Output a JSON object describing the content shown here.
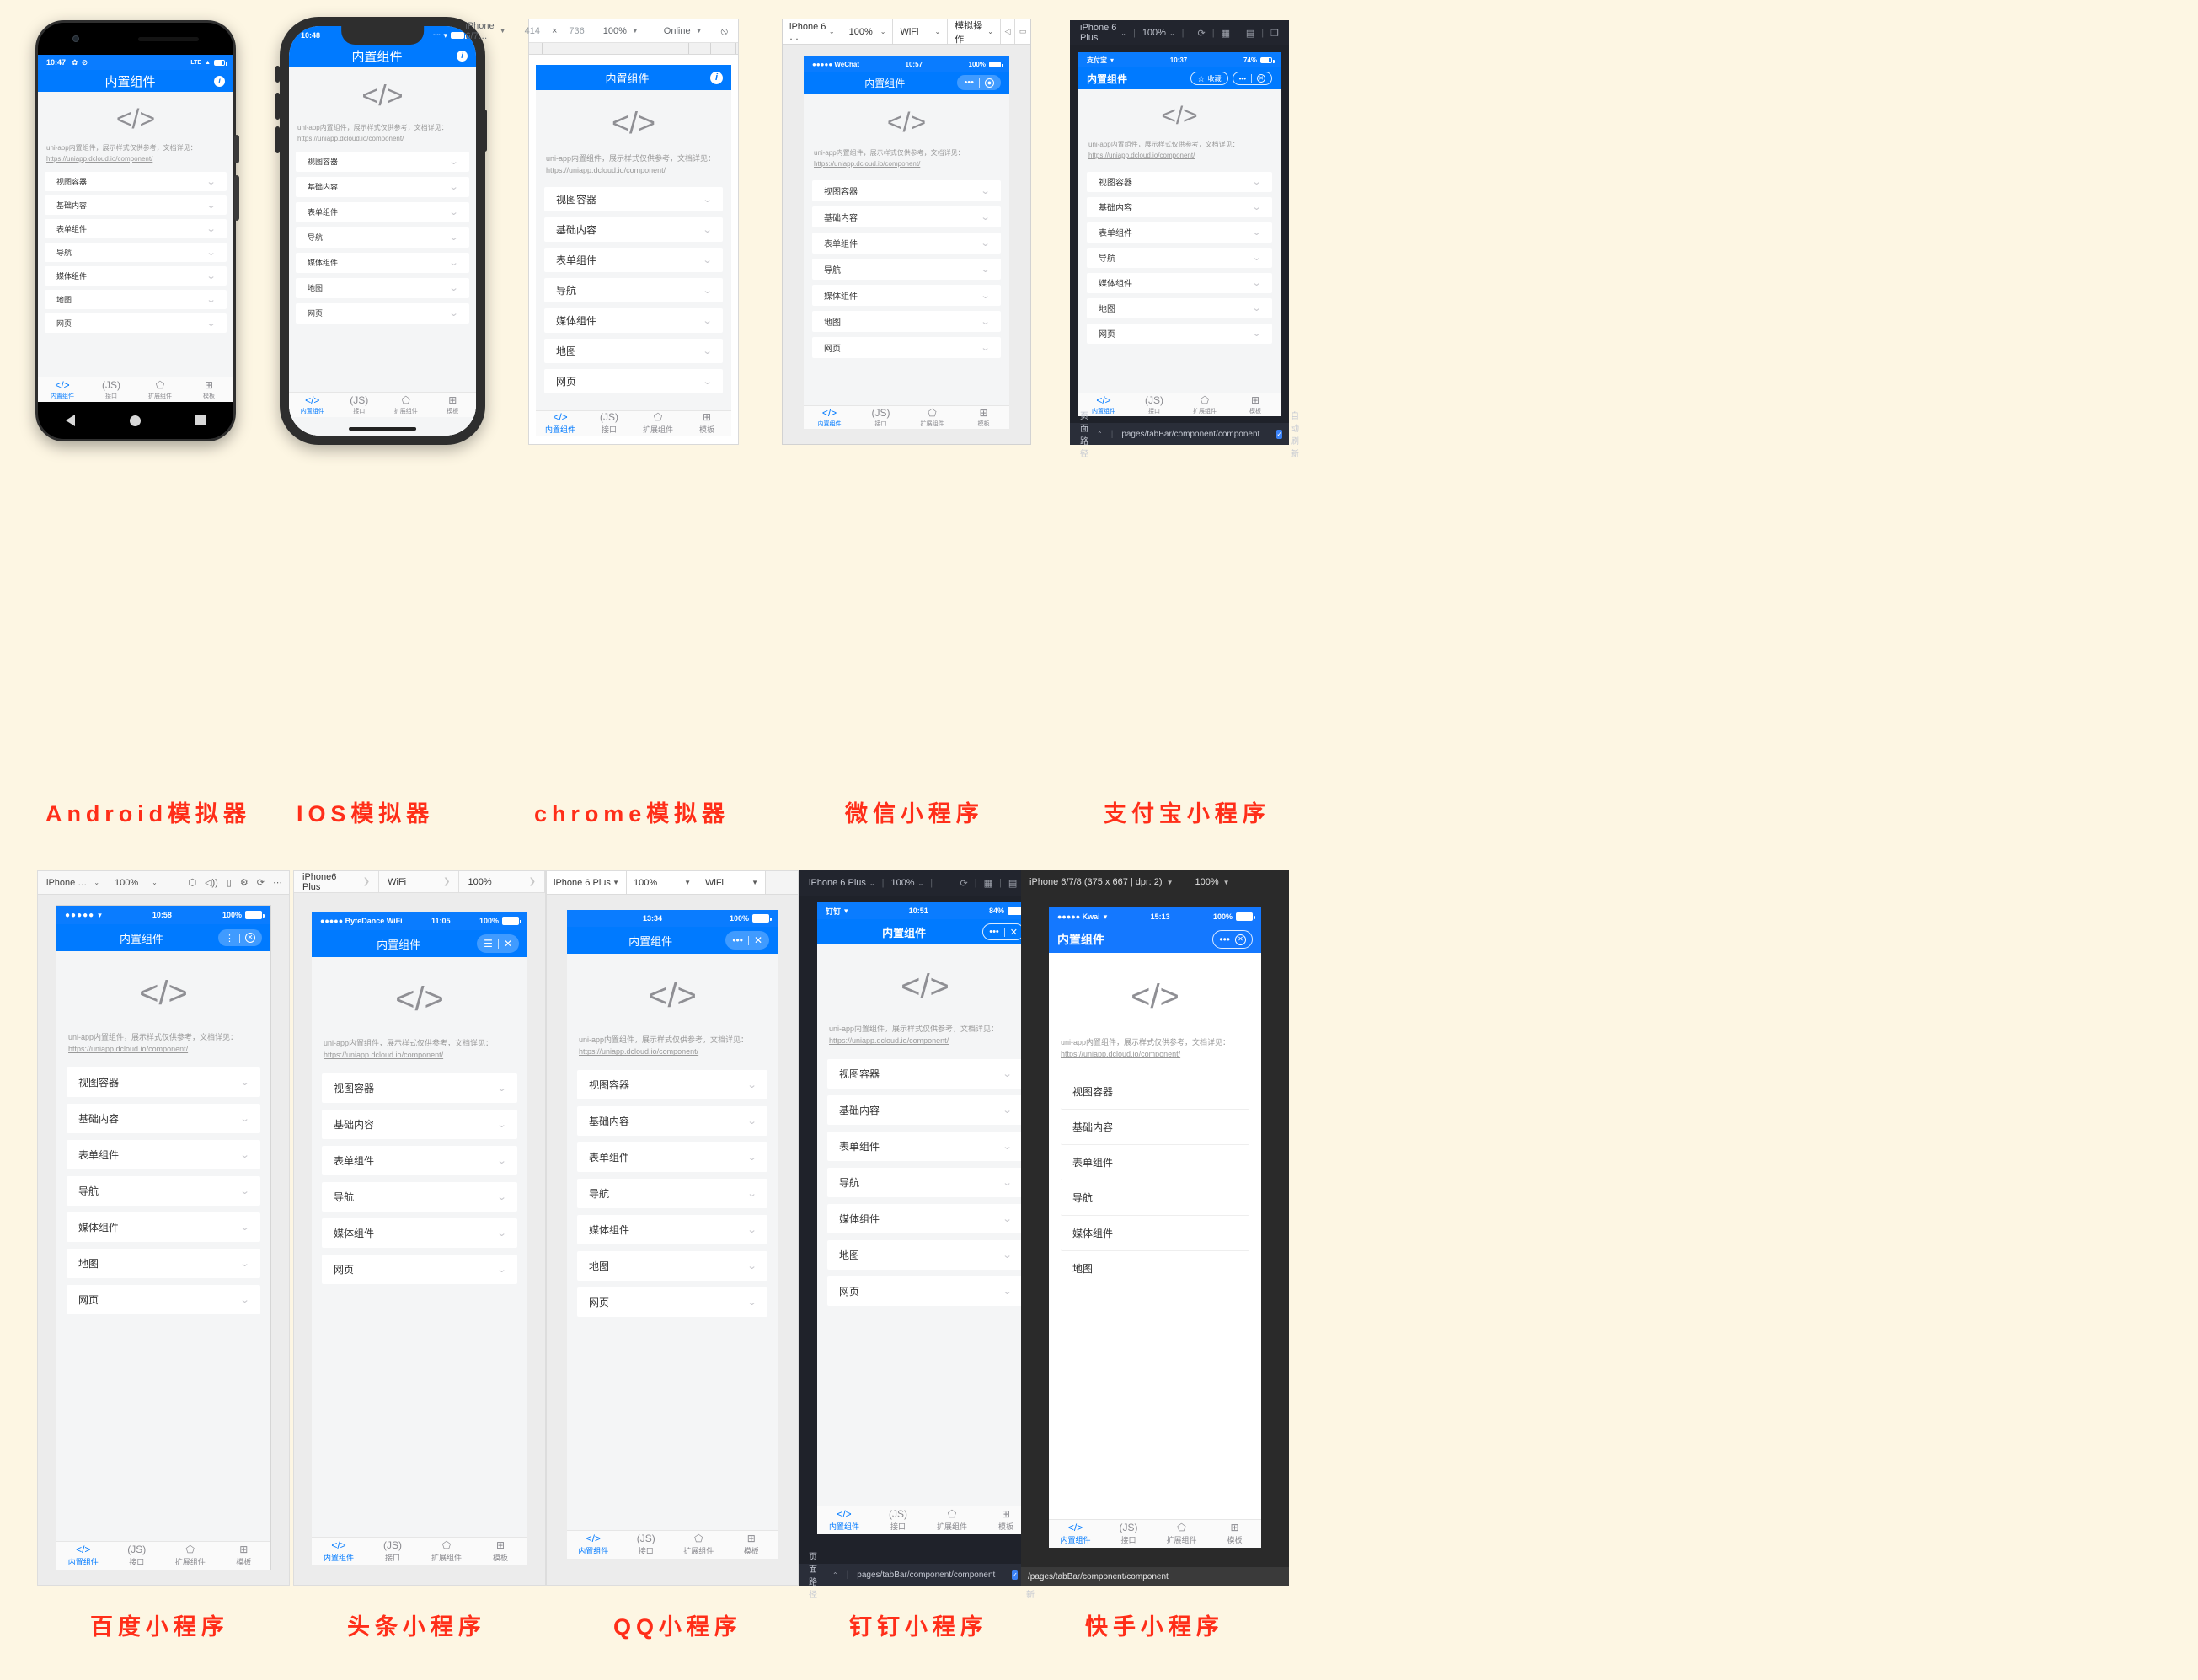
{
  "page": {
    "background": "#FDF6E3",
    "accent_blue": "#007AFF",
    "caption_color": "#FF2E19"
  },
  "app": {
    "title": "内置组件",
    "hero_glyph": "</>",
    "description": "uni-app内置组件，展示样式仅供参考，文档详见：",
    "doc_url": "https://uniapp.dcloud.io/component/",
    "list_items": [
      "视图容器",
      "基础内容",
      "表单组件",
      "导航",
      "媒体组件",
      "地图",
      "网页"
    ],
    "tabs": [
      {
        "icon": "</>",
        "label": "内置组件",
        "active": true
      },
      {
        "icon": "(JS)",
        "label": "接口",
        "active": false
      },
      {
        "icon": "puzzle",
        "label": "扩展组件",
        "active": false
      },
      {
        "icon": "grid",
        "label": "模板",
        "active": false
      }
    ]
  },
  "captions": {
    "android": "Android模拟器",
    "ios": "IOS模拟器",
    "chrome": "chrome模拟器",
    "wechat": "微信小程序",
    "alipay": "支付宝小程序",
    "baidu": "百度小程序",
    "toutiao": "头条小程序",
    "qq": "QQ小程序",
    "dingtalk": "钉钉小程序",
    "kwai": "快手小程序"
  },
  "android": {
    "status_time": "10:47",
    "status_right": "LTE",
    "icons": [
      "gear-icon",
      "sync-disabled-icon"
    ],
    "navbar_info_icon": "info-icon"
  },
  "ios": {
    "status_time": "10:48",
    "wifi": "wifi-icon",
    "navbar_info_icon": "info-icon"
  },
  "chrome": {
    "device": "iPhone 6/7…",
    "width": "414",
    "x": "×",
    "height": "736",
    "zoom": "100%",
    "network": "Online",
    "more_icon": "no-throttle-icon",
    "navbar_info_icon": "info-icon"
  },
  "wechat": {
    "toolbar": [
      {
        "label": "iPhone 6 …",
        "caret": "⌄"
      },
      {
        "label": "100%",
        "caret": "⌄"
      },
      {
        "label": "WiFi",
        "caret": "⌄"
      },
      {
        "label": "模拟操作",
        "caret": "⌄"
      }
    ],
    "right_icons": [
      "prev-page-icon",
      "clear-icon"
    ],
    "carrier": "●●●●● WeChat",
    "status_time": "10:57",
    "battery": "100%",
    "capsule_more": "•••",
    "capsule_close": "⊙"
  },
  "alipay": {
    "device": "iPhone 6 Plus",
    "zoom": "100%",
    "toolbar_icons": [
      "refresh-icon",
      "grid-icon",
      "screenshot-icon",
      "copy-icon"
    ],
    "carrier": "支付宝",
    "status_time": "10:37",
    "battery": "74%",
    "fav_label": "收藏",
    "capsule_more": "•••",
    "capsule_close": "⊗",
    "footer_label": "页面路径",
    "footer_path": "pages/tabBar/component/component",
    "footer_checkbox": "自动刷新",
    "footer_checked": true
  },
  "baidu": {
    "device": "iPhone …",
    "zoom": "100%",
    "toolbar_icons": [
      "cube-icon",
      "volume-icon",
      "device-icon",
      "settings-icon",
      "refresh-icon",
      "more-icon"
    ],
    "carrier": "●●●●●",
    "status_time": "10:58",
    "battery": "100%",
    "capsule_more": "⋮",
    "capsule_close": "⊗"
  },
  "toutiao": {
    "device": "iPhone6 Plus",
    "network": "WiFi",
    "zoom": "100%",
    "carrier": "●●●●● ByteDance WiFi",
    "status_time": "11:05",
    "battery": "100%",
    "capsule_more": "☰",
    "capsule_close": "✕"
  },
  "qq": {
    "device": "iPhone 6 Plus",
    "zoom": "100%",
    "network": "WiFi",
    "status_time": "13:34",
    "battery": "100%",
    "capsule_more": "•••",
    "capsule_close": "✕"
  },
  "dingtalk": {
    "device": "iPhone 6 Plus",
    "zoom": "100%",
    "toolbar_icons": [
      "refresh-icon",
      "grid-icon",
      "screenshot-icon",
      "copy-icon"
    ],
    "carrier": "钉钉",
    "status_time": "10:51",
    "battery": "84%",
    "capsule_more": "•••",
    "capsule_close": "✕",
    "footer_label": "页面路径",
    "footer_path": "pages/tabBar/component/component",
    "footer_checkbox": "自动刷新",
    "footer_checked": true
  },
  "kwai": {
    "device": "iPhone 6/7/8 (375 x 667 | dpr: 2)",
    "zoom": "100%",
    "carrier": "●●●●● Kwai",
    "status_time": "15:13",
    "battery": "100%",
    "capsule_more": "•••",
    "capsule_close": "⊗",
    "footer_path": "/pages/tabBar/component/component",
    "list_items": [
      "视图容器",
      "基础内容",
      "表单组件",
      "导航",
      "媒体组件",
      "地图"
    ]
  }
}
